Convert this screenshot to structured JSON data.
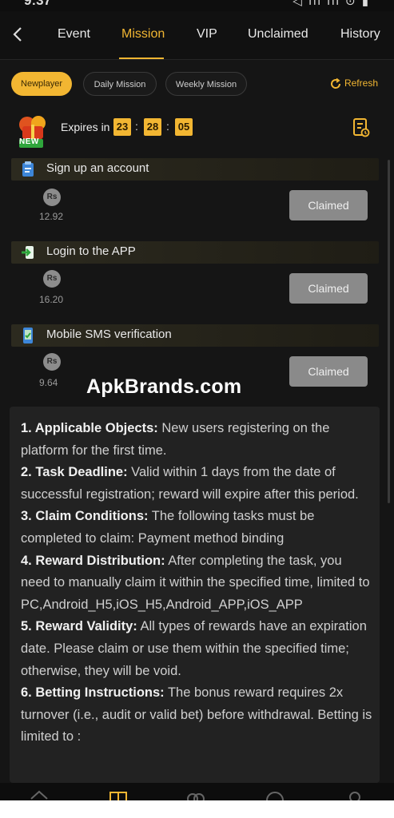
{
  "status_bar": {
    "time": "9:37",
    "icons": "◁ ıll ıll ⊙ ▮"
  },
  "nav": {
    "back_icon": "chevron-left-icon",
    "tabs": [
      {
        "label": "Event"
      },
      {
        "label": "Mission",
        "active": true
      },
      {
        "label": "VIP"
      },
      {
        "label": "Unclaimed"
      },
      {
        "label": "History"
      }
    ]
  },
  "filters": {
    "chips": [
      "Newplayer",
      "Daily Mission",
      "Weekly Mission"
    ],
    "selected": "Newplayer",
    "refresh_label": "Refresh"
  },
  "expiry": {
    "badge": "NEW",
    "label": "Expires in",
    "hours": "23",
    "minutes": "28",
    "seconds": "05"
  },
  "tasks": [
    {
      "title": "Sign up an account",
      "currency": "Rs",
      "amount": "12.92",
      "button": "Claimed"
    },
    {
      "title": "Login to the APP",
      "currency": "Rs",
      "amount": "16.20",
      "button": "Claimed"
    },
    {
      "title": "Mobile SMS verification",
      "currency": "Rs",
      "amount": "9.64",
      "button": "Claimed"
    }
  ],
  "watermark": "ApkBrands.com",
  "rules": [
    {
      "heading": "1. Applicable Objects:",
      "text": " New users registering on the platform for the first time."
    },
    {
      "heading": "2. Task Deadline:",
      "text": " Valid within 1 days from the date of successful registration; reward will expire after this period."
    },
    {
      "heading": "3. Claim Conditions:",
      "text": " The following tasks must be completed to claim: Payment method binding"
    },
    {
      "heading": "4. Reward Distribution:",
      "text": " After completing the task, you need to manually claim it within the specified time, limited to PC,Android_H5,iOS_H5,Android_APP,iOS_APP"
    },
    {
      "heading": "5. Reward Validity:",
      "text": " All types of rewards have an expiration date. Please claim or use them within the specified time; otherwise, they will be void."
    },
    {
      "heading": "6. Betting Instructions:",
      "text": " The bonus reward requires 2x turnover (i.e., audit or valid bet) before withdrawal. Betting is limited to :"
    }
  ],
  "colors": {
    "accent": "#f2b632",
    "background": "#151515",
    "claimed_button": "#8a8a8a"
  }
}
